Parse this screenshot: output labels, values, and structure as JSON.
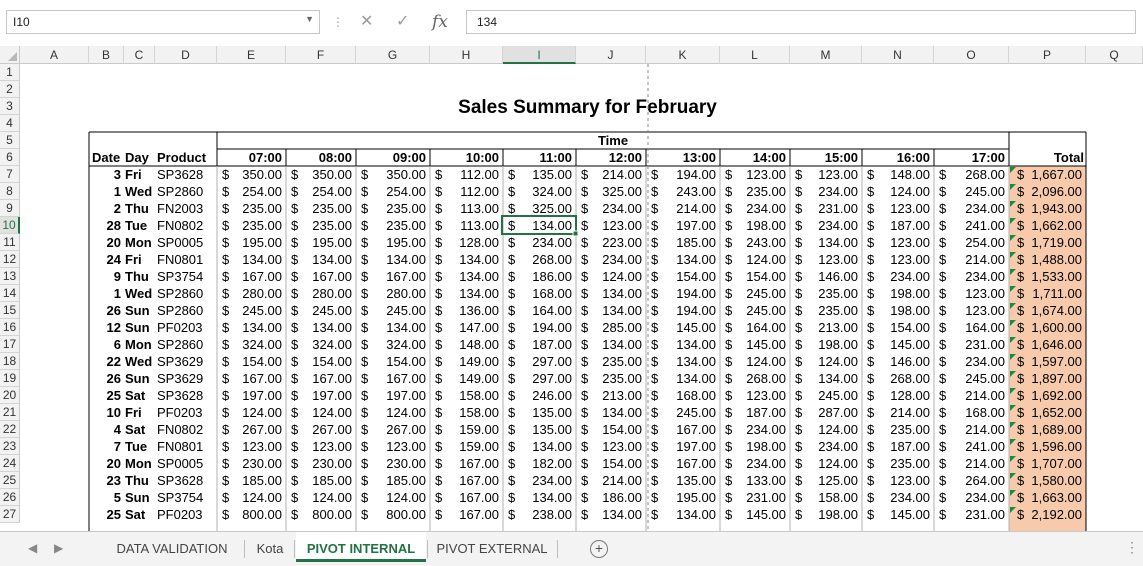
{
  "formula_bar": {
    "name_box": "I10",
    "formula": "134"
  },
  "columns": [
    "A",
    "B",
    "C",
    "D",
    "E",
    "F",
    "G",
    "H",
    "I",
    "J",
    "K",
    "L",
    "M",
    "N",
    "O",
    "P",
    "Q"
  ],
  "rows": [
    "1",
    "2",
    "3",
    "4",
    "5",
    "6",
    "7",
    "8",
    "9",
    "10",
    "11",
    "12",
    "13",
    "14",
    "15",
    "16",
    "17",
    "18",
    "19",
    "20",
    "21",
    "22",
    "23",
    "24",
    "25",
    "26",
    "27"
  ],
  "sheet": {
    "title": "Sales Summary for February",
    "time_label": "Time",
    "headers": {
      "date": "Date",
      "day": "Day",
      "product": "Product",
      "times": [
        "07:00",
        "08:00",
        "09:00",
        "10:00",
        "11:00",
        "12:00",
        "13:00",
        "14:00",
        "15:00",
        "16:00",
        "17:00"
      ],
      "total": "Total"
    },
    "currency": "$",
    "records": [
      {
        "date": "3",
        "day": "Fri",
        "product": "SP3628",
        "values": [
          "350.00",
          "350.00",
          "350.00",
          "112.00",
          "135.00",
          "214.00",
          "194.00",
          "123.00",
          "123.00",
          "148.00",
          "268.00"
        ],
        "total": "1,667.00"
      },
      {
        "date": "1",
        "day": "Wed",
        "product": "SP2860",
        "values": [
          "254.00",
          "254.00",
          "254.00",
          "112.00",
          "324.00",
          "325.00",
          "243.00",
          "235.00",
          "234.00",
          "124.00",
          "245.00"
        ],
        "total": "2,096.00"
      },
      {
        "date": "2",
        "day": "Thu",
        "product": "FN2003",
        "values": [
          "235.00",
          "235.00",
          "235.00",
          "113.00",
          "325.00",
          "234.00",
          "214.00",
          "234.00",
          "231.00",
          "123.00",
          "234.00"
        ],
        "total": "1,943.00"
      },
      {
        "date": "28",
        "day": "Tue",
        "product": "FN0802",
        "values": [
          "235.00",
          "235.00",
          "235.00",
          "113.00",
          "134.00",
          "123.00",
          "197.00",
          "198.00",
          "234.00",
          "187.00",
          "241.00"
        ],
        "total": "1,662.00"
      },
      {
        "date": "20",
        "day": "Mon",
        "product": "SP0005",
        "values": [
          "195.00",
          "195.00",
          "195.00",
          "128.00",
          "234.00",
          "223.00",
          "185.00",
          "243.00",
          "134.00",
          "123.00",
          "254.00"
        ],
        "total": "1,719.00"
      },
      {
        "date": "24",
        "day": "Fri",
        "product": "FN0801",
        "values": [
          "134.00",
          "134.00",
          "134.00",
          "134.00",
          "268.00",
          "234.00",
          "134.00",
          "124.00",
          "123.00",
          "123.00",
          "214.00"
        ],
        "total": "1,488.00"
      },
      {
        "date": "9",
        "day": "Thu",
        "product": "SP3754",
        "values": [
          "167.00",
          "167.00",
          "167.00",
          "134.00",
          "186.00",
          "124.00",
          "154.00",
          "154.00",
          "146.00",
          "234.00",
          "234.00"
        ],
        "total": "1,533.00"
      },
      {
        "date": "1",
        "day": "Wed",
        "product": "SP2860",
        "values": [
          "280.00",
          "280.00",
          "280.00",
          "134.00",
          "168.00",
          "134.00",
          "194.00",
          "245.00",
          "235.00",
          "198.00",
          "123.00"
        ],
        "total": "1,711.00"
      },
      {
        "date": "26",
        "day": "Sun",
        "product": "SP2860",
        "values": [
          "245.00",
          "245.00",
          "245.00",
          "136.00",
          "164.00",
          "134.00",
          "194.00",
          "245.00",
          "235.00",
          "198.00",
          "123.00"
        ],
        "total": "1,674.00"
      },
      {
        "date": "12",
        "day": "Sun",
        "product": "PF0203",
        "values": [
          "134.00",
          "134.00",
          "134.00",
          "147.00",
          "194.00",
          "285.00",
          "145.00",
          "164.00",
          "213.00",
          "154.00",
          "164.00"
        ],
        "total": "1,600.00"
      },
      {
        "date": "6",
        "day": "Mon",
        "product": "SP2860",
        "values": [
          "324.00",
          "324.00",
          "324.00",
          "148.00",
          "187.00",
          "134.00",
          "134.00",
          "145.00",
          "198.00",
          "145.00",
          "231.00"
        ],
        "total": "1,646.00"
      },
      {
        "date": "22",
        "day": "Wed",
        "product": "SP3629",
        "values": [
          "154.00",
          "154.00",
          "154.00",
          "149.00",
          "297.00",
          "235.00",
          "134.00",
          "124.00",
          "124.00",
          "146.00",
          "234.00"
        ],
        "total": "1,597.00"
      },
      {
        "date": "26",
        "day": "Sun",
        "product": "SP3629",
        "values": [
          "167.00",
          "167.00",
          "167.00",
          "149.00",
          "297.00",
          "235.00",
          "134.00",
          "268.00",
          "134.00",
          "268.00",
          "245.00"
        ],
        "total": "1,897.00"
      },
      {
        "date": "25",
        "day": "Sat",
        "product": "SP3628",
        "values": [
          "197.00",
          "197.00",
          "197.00",
          "158.00",
          "246.00",
          "213.00",
          "168.00",
          "123.00",
          "245.00",
          "128.00",
          "214.00"
        ],
        "total": "1,692.00"
      },
      {
        "date": "10",
        "day": "Fri",
        "product": "PF0203",
        "values": [
          "124.00",
          "124.00",
          "124.00",
          "158.00",
          "135.00",
          "134.00",
          "245.00",
          "187.00",
          "287.00",
          "214.00",
          "168.00"
        ],
        "total": "1,652.00"
      },
      {
        "date": "4",
        "day": "Sat",
        "product": "FN0802",
        "values": [
          "267.00",
          "267.00",
          "267.00",
          "159.00",
          "135.00",
          "154.00",
          "167.00",
          "234.00",
          "124.00",
          "235.00",
          "214.00"
        ],
        "total": "1,689.00"
      },
      {
        "date": "7",
        "day": "Tue",
        "product": "FN0801",
        "values": [
          "123.00",
          "123.00",
          "123.00",
          "159.00",
          "134.00",
          "123.00",
          "197.00",
          "198.00",
          "234.00",
          "187.00",
          "241.00"
        ],
        "total": "1,596.00"
      },
      {
        "date": "20",
        "day": "Mon",
        "product": "SP0005",
        "values": [
          "230.00",
          "230.00",
          "230.00",
          "167.00",
          "182.00",
          "154.00",
          "167.00",
          "234.00",
          "124.00",
          "235.00",
          "214.00"
        ],
        "total": "1,707.00"
      },
      {
        "date": "23",
        "day": "Thu",
        "product": "SP3628",
        "values": [
          "185.00",
          "185.00",
          "185.00",
          "167.00",
          "234.00",
          "214.00",
          "135.00",
          "133.00",
          "125.00",
          "123.00",
          "264.00"
        ],
        "total": "1,580.00"
      },
      {
        "date": "5",
        "day": "Sun",
        "product": "SP3754",
        "values": [
          "124.00",
          "124.00",
          "124.00",
          "167.00",
          "134.00",
          "186.00",
          "195.00",
          "231.00",
          "158.00",
          "234.00",
          "234.00"
        ],
        "total": "1,663.00"
      },
      {
        "date": "25",
        "day": "Sat",
        "product": "PF0203",
        "values": [
          "800.00",
          "800.00",
          "800.00",
          "167.00",
          "238.00",
          "134.00",
          "134.00",
          "145.00",
          "198.00",
          "145.00",
          "231.00"
        ],
        "total": "2,192.00"
      }
    ]
  },
  "tabs": [
    {
      "label": "DATA VALIDATION",
      "active": false
    },
    {
      "label": "Kota",
      "active": false
    },
    {
      "label": "PIVOT INTERNAL",
      "active": true
    },
    {
      "label": "PIVOT EXTERNAL",
      "active": false
    }
  ],
  "active_cell": {
    "column": "I",
    "row": "10"
  },
  "colors": {
    "accent": "#217346",
    "total_fill": "#f7caac",
    "error_marker": "#1e8a3c"
  }
}
